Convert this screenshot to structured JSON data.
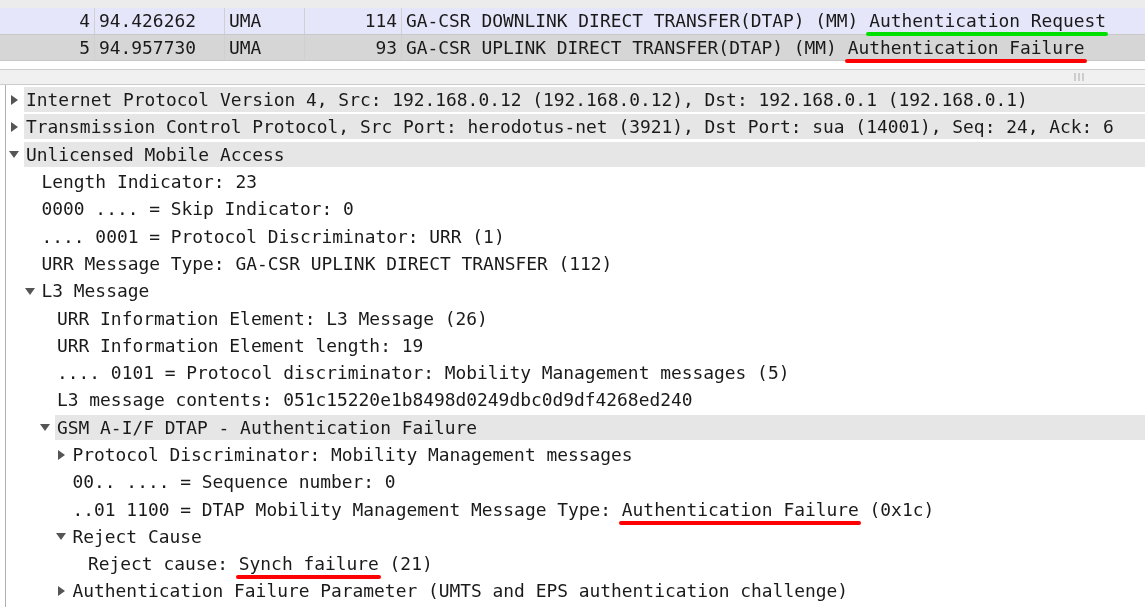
{
  "packet_list": {
    "rows": [
      {
        "no": "4",
        "time": "94.426262",
        "protocol": "UMA",
        "length": "114",
        "info": "GA-CSR DOWNLINK DIRECT TRANSFER(DTAP) (MM)",
        "info_highlight": "Authentication Request",
        "color": "#00e000",
        "selected": false
      },
      {
        "no": "5",
        "time": "94.957730",
        "protocol": "UMA",
        "length": "93",
        "info": "GA-CSR UPLINK DIRECT TRANSFER(DTAP) (MM)",
        "info_highlight": "Authentication Failure",
        "color": "#ff0000",
        "selected": true
      }
    ]
  },
  "details": [
    {
      "parts": [
        {
          "text": "Internet Protocol Version 4, Src: 192.168.0.12 (192.168.0.12), Dst: 192.168.0.1 (192.168.0.1)"
        }
      ],
      "expanded": false,
      "highlighted": true
    },
    {
      "parts": [
        {
          "text": "Transmission Control Protocol, Src Port: herodotus-net (3921), Dst Port: sua (14001), Seq: 24, Ack: 6"
        }
      ],
      "expanded": false,
      "highlighted": true
    },
    {
      "parts": [
        {
          "text": "Unlicensed Mobile Access"
        }
      ],
      "expanded": true,
      "highlighted": true,
      "children": [
        {
          "parts": [
            {
              "text": "Length Indicator: 23"
            }
          ],
          "highlighted": false
        },
        {
          "parts": [
            {
              "text": "0000 .... = Skip Indicator: 0"
            }
          ],
          "highlighted": false
        },
        {
          "parts": [
            {
              "text": ".... 0001 = Protocol Discriminator: URR (1)"
            }
          ],
          "highlighted": false
        },
        {
          "parts": [
            {
              "text": "URR Message Type: GA-CSR UPLINK DIRECT TRANSFER (112)"
            }
          ],
          "highlighted": false
        },
        {
          "parts": [
            {
              "text": "L3 Message"
            }
          ],
          "expanded": true,
          "highlighted": false,
          "children": [
            {
              "parts": [
                {
                  "text": "URR Information Element: L3 Message (26)"
                }
              ],
              "highlighted": false
            },
            {
              "parts": [
                {
                  "text": "URR Information Element length: 19"
                }
              ],
              "highlighted": false
            },
            {
              "parts": [
                {
                  "text": ".... 0101 = Protocol discriminator: Mobility Management messages (5)"
                }
              ],
              "highlighted": false
            },
            {
              "parts": [
                {
                  "text": "L3 message contents: 051c15220e1b8498d0249dbc0d9df4268ed240"
                }
              ],
              "highlighted": false
            },
            {
              "parts": [
                {
                  "text": "GSM A-I/F DTAP - Authentication Failure"
                }
              ],
              "expanded": true,
              "highlighted": true,
              "children": [
                {
                  "parts": [
                    {
                      "text": "Protocol Discriminator: Mobility Management messages"
                    }
                  ],
                  "expanded": false,
                  "highlighted": false
                },
                {
                  "parts": [
                    {
                      "text": "00.. .... = Sequence number: 0"
                    }
                  ],
                  "highlighted": false
                },
                {
                  "parts": [
                    {
                      "text": "..01 1100 = DTAP Mobility Management Message Type: "
                    },
                    {
                      "text": "Authentication Failure",
                      "color": "#ff0000"
                    },
                    {
                      "text": " (0x1c)"
                    }
                  ],
                  "highlighted": false
                },
                {
                  "parts": [
                    {
                      "text": "Reject Cause"
                    }
                  ],
                  "expanded": true,
                  "highlighted": false,
                  "children": [
                    {
                      "parts": [
                        {
                          "text": "Reject cause: "
                        },
                        {
                          "text": "Synch failure",
                          "color": "#ff0000"
                        },
                        {
                          "text": " (21)"
                        }
                      ],
                      "highlighted": false
                    }
                  ]
                },
                {
                  "parts": [
                    {
                      "text": "Authentication Failure Parameter (UMTS and EPS authentication challenge)"
                    }
                  ],
                  "expanded": false,
                  "highlighted": false
                }
              ]
            }
          ]
        }
      ]
    }
  ]
}
